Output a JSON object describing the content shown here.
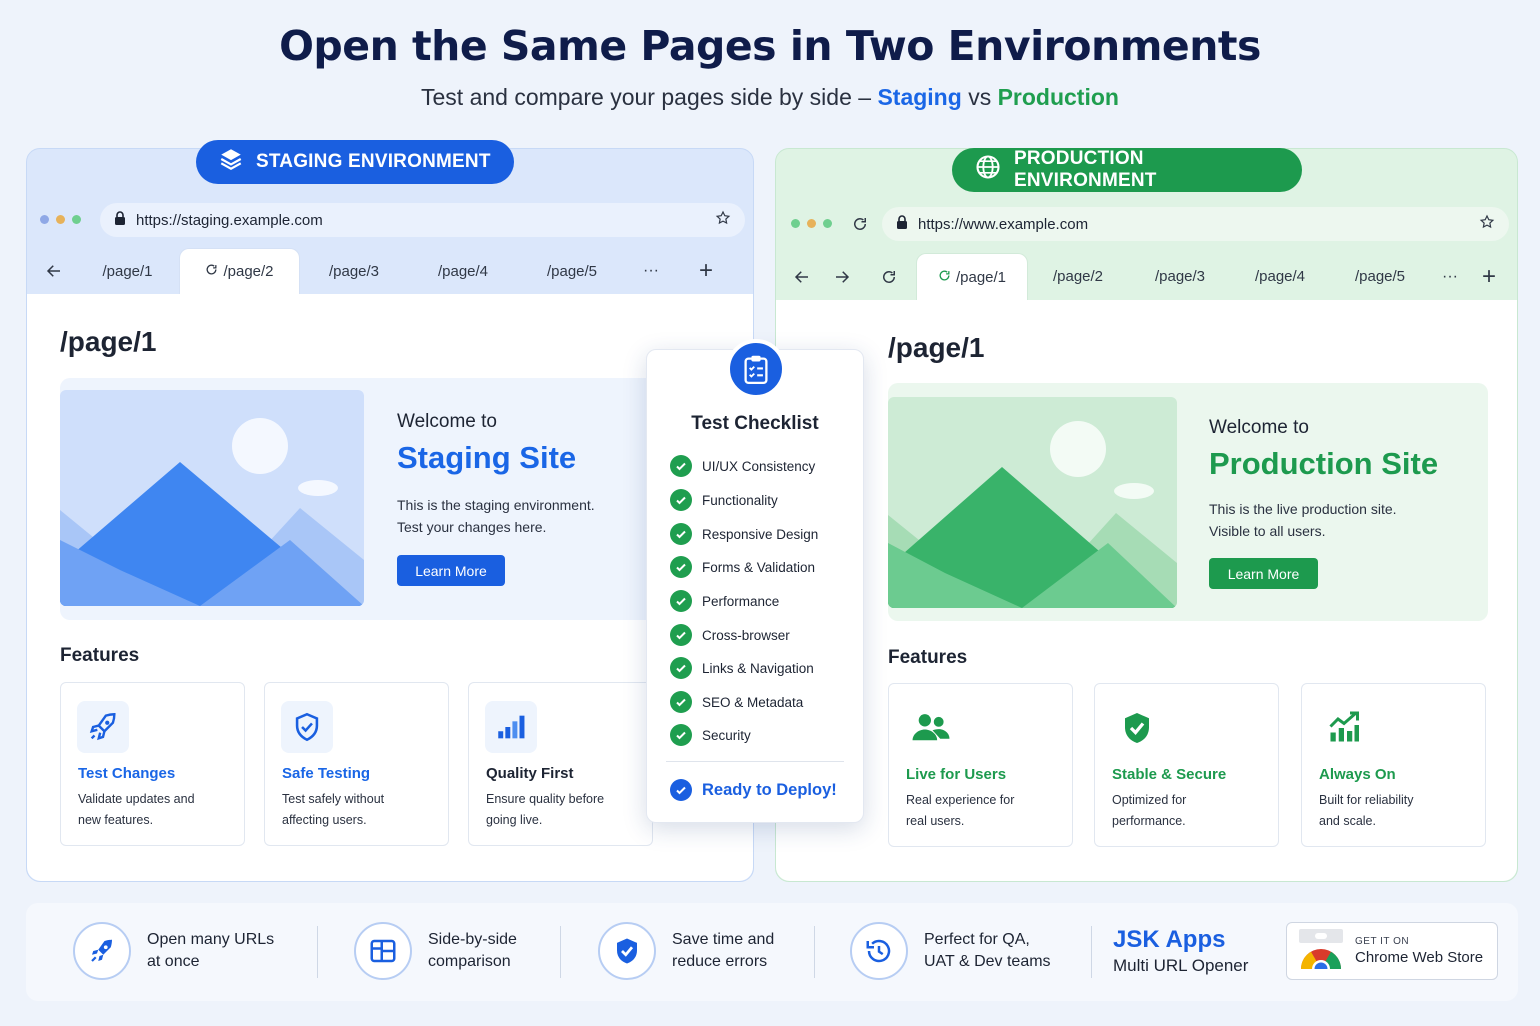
{
  "header": {
    "title": "Open the Same Pages in Two Environments",
    "subtitle_prefix": "Test and compare your pages side by side –",
    "subtitle_staging": "Staging",
    "subtitle_vs": "vs",
    "subtitle_production": "Production"
  },
  "staging": {
    "pill": "STAGING ENVIRONMENT",
    "url": "https://staging.example.com",
    "tabs": [
      "/page/1",
      "/page/2",
      "/page/3",
      "/page/4",
      "/page/5"
    ],
    "more": "···",
    "add": "+",
    "page_heading": "/page/1",
    "welcome": "Welcome to",
    "site_name": "Staging Site",
    "desc_line1": "This is the staging environment.",
    "desc_line2": "Test your changes here.",
    "button": "Learn More",
    "features_heading": "Features",
    "features": [
      {
        "title": "Test Changes",
        "desc1": "Validate updates and",
        "desc2": "new features."
      },
      {
        "title": "Safe Testing",
        "desc1": "Test safely without",
        "desc2": "affecting users."
      },
      {
        "title": "Quality First",
        "desc1": "Ensure quality before",
        "desc2": "going live."
      }
    ]
  },
  "production": {
    "pill": "PRODUCTION ENVIRONMENT",
    "url": "https://www.example.com",
    "tabs": [
      "/page/1",
      "/page/2",
      "/page/3",
      "/page/4",
      "/page/5"
    ],
    "more": "···",
    "add": "+",
    "page_heading": "/page/1",
    "welcome": "Welcome to",
    "site_name": "Production Site",
    "desc_line1": "This is the live production site.",
    "desc_line2": "Visible to all users.",
    "button": "Learn More",
    "features_heading": "Features",
    "features": [
      {
        "title": "Live for Users",
        "desc1": "Real experience for",
        "desc2": "real users."
      },
      {
        "title": "Stable & Secure",
        "desc1": "Optimized for",
        "desc2": "performance."
      },
      {
        "title": "Always On",
        "desc1": "Built for reliability",
        "desc2": "and scale."
      }
    ]
  },
  "checklist": {
    "title": "Test Checklist",
    "items": [
      "UI/UX Consistency",
      "Functionality",
      "Responsive Design",
      "Forms & Validation",
      "Performance",
      "Cross-browser",
      "Links & Navigation",
      "SEO & Metadata",
      "Security"
    ],
    "ready": "Ready to Deploy!"
  },
  "footer": {
    "items": [
      {
        "line1": "Open many URLs",
        "line2": "at once",
        "icon": "rocket-icon"
      },
      {
        "line1": "Side-by-side",
        "line2": "comparison",
        "icon": "layout-icon"
      },
      {
        "line1": "Save time and",
        "line2": "reduce errors",
        "icon": "shield-check-icon"
      },
      {
        "line1": "Perfect for QA,",
        "line2": "UAT & Dev teams",
        "icon": "history-icon"
      }
    ],
    "brand_name": "JSK Apps",
    "brand_sub": "Multi URL Opener",
    "store_small": "GET IT ON",
    "store_big": "Chrome Web Store"
  },
  "colors": {
    "staging_accent": "#1a5fe0",
    "production_accent": "#1d9a4e"
  }
}
